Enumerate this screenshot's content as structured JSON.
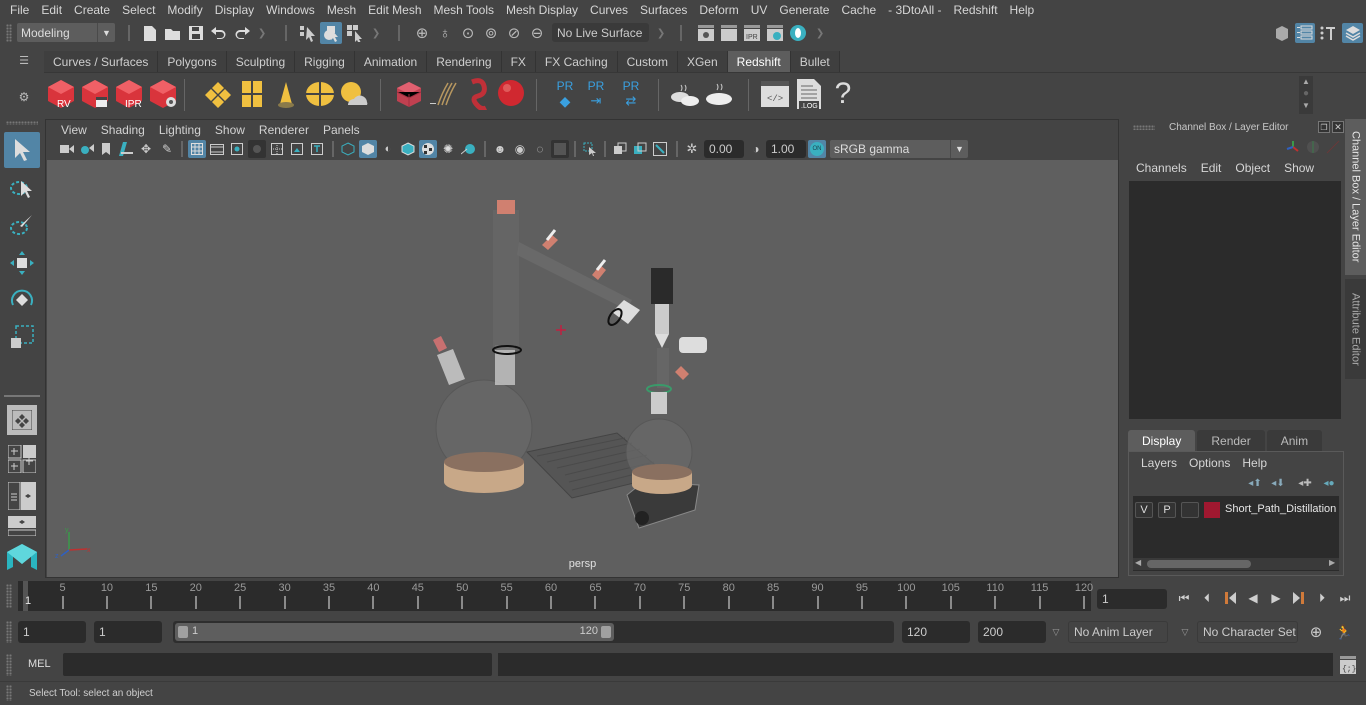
{
  "menubar": {
    "items": [
      "File",
      "Edit",
      "Create",
      "Select",
      "Modify",
      "Display",
      "Windows",
      "Mesh",
      "Edit Mesh",
      "Mesh Tools",
      "Mesh Display",
      "Curves",
      "Surfaces",
      "Deform",
      "UV",
      "Generate",
      "Cache",
      "- 3DtoAll -",
      "Redshift",
      "Help"
    ]
  },
  "statusline": {
    "mode": "Modeling",
    "live_surface": "No Live Surface"
  },
  "shelf": {
    "tabs": [
      "Curves / Surfaces",
      "Polygons",
      "Sculpting",
      "Rigging",
      "Animation",
      "Rendering",
      "FX",
      "FX Caching",
      "Custom",
      "XGen",
      "Redshift",
      "Bullet"
    ],
    "active_tab": "Redshift",
    "icons": [
      {
        "name": "redshift-render-view-icon",
        "label": "RV"
      },
      {
        "name": "redshift-batch-render-icon",
        "label": ""
      },
      {
        "name": "redshift-ipr-icon",
        "label": "IPR"
      },
      {
        "name": "redshift-settings-icon",
        "label": ""
      },
      {
        "name": "redshift-light-icon",
        "label": ""
      },
      {
        "name": "redshift-area-light-icon",
        "label": ""
      },
      {
        "name": "redshift-spot-light-icon",
        "label": ""
      },
      {
        "name": "redshift-dome-light-icon",
        "label": ""
      },
      {
        "name": "redshift-sun-sky-icon",
        "label": ""
      },
      {
        "name": "redshift-proxy-icon",
        "label": ""
      },
      {
        "name": "redshift-hair-icon",
        "label": ""
      },
      {
        "name": "redshift-volume-icon",
        "label": ""
      },
      {
        "name": "redshift-sphere-icon",
        "label": ""
      },
      {
        "name": "redshift-pr-create-icon",
        "label": "PR"
      },
      {
        "name": "redshift-pr-export-icon",
        "label": "PR"
      },
      {
        "name": "redshift-pr-convert-icon",
        "label": "PR"
      },
      {
        "name": "redshift-bake-multiple-icon",
        "label": ""
      },
      {
        "name": "redshift-bake-icon",
        "label": ""
      },
      {
        "name": "redshift-script-icon",
        "label": "</>"
      },
      {
        "name": "redshift-log-icon",
        "label": ".LOG"
      },
      {
        "name": "help-icon",
        "label": "?"
      }
    ]
  },
  "viewport": {
    "menu": [
      "View",
      "Shading",
      "Lighting",
      "Show",
      "Renderer",
      "Panels"
    ],
    "exposure": "0.00",
    "gamma": "1.00",
    "color_mgmt_badge": "ON",
    "color_space": "sRGB gamma",
    "camera_label": "persp"
  },
  "channel_box": {
    "title": "Channel Box / Layer Editor",
    "menu": [
      "Channels",
      "Edit",
      "Object",
      "Show"
    ]
  },
  "layer_editor": {
    "tabs": [
      "Display",
      "Render",
      "Anim"
    ],
    "active_tab": "Display",
    "menu": [
      "Layers",
      "Options",
      "Help"
    ],
    "layers": [
      {
        "visible": "V",
        "playback": "P",
        "name": "Short_Path_Distillation",
        "color": "#a01830"
      }
    ]
  },
  "side_tabs": [
    "Channel Box / Layer Editor",
    "Attribute Editor"
  ],
  "timeline": {
    "ticks": [
      5,
      10,
      15,
      20,
      25,
      30,
      35,
      40,
      45,
      50,
      55,
      60,
      65,
      70,
      75,
      80,
      85,
      90,
      95,
      100,
      105,
      110,
      115,
      120
    ],
    "start_frame_marker": "1",
    "current_frame": "1",
    "min": 1,
    "max": 120
  },
  "range": {
    "start_time": "1",
    "playback_start": "1",
    "range_start_label": "1",
    "range_end_label": "120",
    "playback_end": "120",
    "end_time": "200",
    "anim_layer": "No Anim Layer",
    "character_set": "No Character Set"
  },
  "command_line": {
    "lang": "MEL",
    "input": "",
    "output": ""
  },
  "help_line": "Select Tool: select an object",
  "colors": {
    "accent": "#5285a6",
    "teal": "#3ab0c0",
    "redshift_red": "#d9343c",
    "layer_color": "#a01830"
  }
}
